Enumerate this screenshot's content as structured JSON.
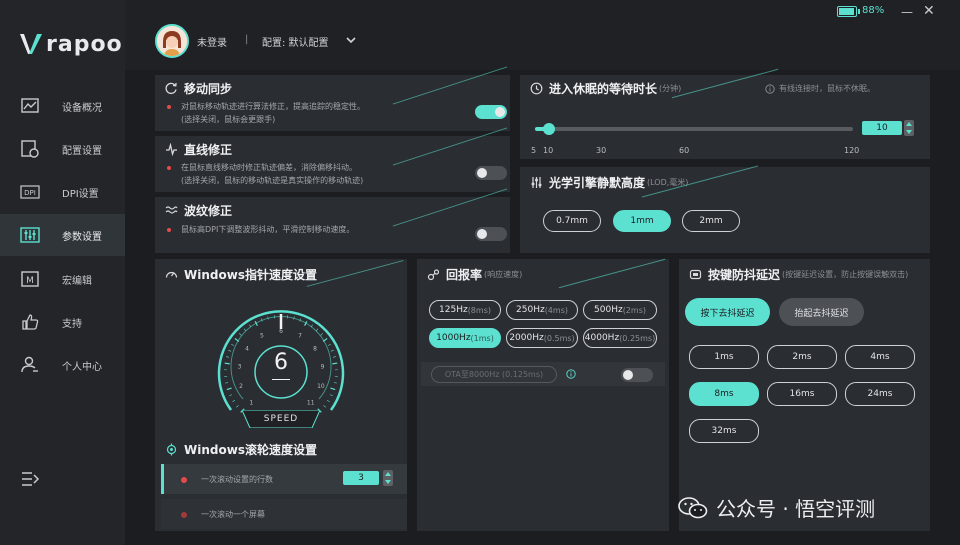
{
  "brand": {
    "name": "rapoo"
  },
  "window": {
    "battery": "88%",
    "battery_level": 0.88,
    "minimize": "—",
    "close": "✕"
  },
  "user": {
    "login_status": "未登录",
    "separator": "|",
    "config_label": "配置: 默认配置"
  },
  "sidebar": {
    "items": [
      {
        "label": "设备概况",
        "icon": "chart-icon"
      },
      {
        "label": "配置设置",
        "icon": "config-icon"
      },
      {
        "label": "DPI设置",
        "icon": "dpi-icon"
      },
      {
        "label": "参数设置",
        "icon": "sliders-icon",
        "active": true
      },
      {
        "label": "宏编辑",
        "icon": "macro-icon"
      },
      {
        "label": "支持",
        "icon": "thumbs-up-icon"
      },
      {
        "label": "个人中心",
        "icon": "user-icon"
      }
    ]
  },
  "motion_sync": {
    "title": "移动同步",
    "desc1": "对鼠标移动轨迹进行算法修正，提高追踪的稳定性。",
    "desc2": "(选择关闭，鼠标会更跟手)",
    "enabled": true
  },
  "line_correction": {
    "title": "直线修正",
    "desc1": "在鼠标直线移动时修正轨迹偏差，消除偏移抖动。",
    "desc2": "(选择关闭，鼠标的移动轨迹是真实操作的移动轨迹)",
    "enabled": false
  },
  "ripple_correction": {
    "title": "波纹修正",
    "desc1": "鼠标高DPI下调整波形抖动，平滑控制移动速度。",
    "enabled": false
  },
  "sleep": {
    "title": "进入休眠的等待时长",
    "unit": "(分钟)",
    "note": "有线连接时，鼠标不休眠。",
    "value": "10",
    "min": 5,
    "max": 120,
    "ticks": [
      "5",
      "10",
      "30",
      "60",
      "120"
    ]
  },
  "lod": {
    "title": "光学引擎静默高度",
    "unit": "(LOD,毫米)",
    "options": [
      "0.7mm",
      "1mm",
      "2mm"
    ],
    "selected": "1mm"
  },
  "pointer_speed": {
    "title": "Windows指针速度设置",
    "value": "6",
    "label": "SPEED",
    "dial_ticks": [
      "1",
      "2",
      "3",
      "4",
      "5",
      "6",
      "7",
      "8",
      "9",
      "10",
      "11"
    ]
  },
  "wheel_speed": {
    "title": "Windows滚轮速度设置",
    "row1": "一次滚动设置的行数",
    "row1_value": "3",
    "row2": "一次滚动一个屏幕"
  },
  "polling": {
    "title": "回报率",
    "unit": "(响应速度)",
    "options": [
      {
        "main": "125Hz",
        "sub": "(8ms)"
      },
      {
        "main": "250Hz",
        "sub": "(4ms)"
      },
      {
        "main": "500Hz",
        "sub": "(2ms)"
      },
      {
        "main": "1000Hz",
        "sub": "(1ms)",
        "selected": true
      },
      {
        "main": "2000Hz",
        "sub": "(0.5ms)"
      },
      {
        "main": "4000Hz",
        "sub": "(0.25ms)"
      }
    ],
    "ota_label": "OTA至8000Hz (0.125ms)",
    "ota_enabled": false
  },
  "debounce": {
    "title": "按键防抖延迟",
    "note": "(按键延迟设置，防止按键误触双击)",
    "press_btn": "按下去抖延迟",
    "release_btn": "抬起去抖延迟",
    "options": [
      "1ms",
      "2ms",
      "4ms",
      "8ms",
      "16ms",
      "24ms",
      "32ms"
    ],
    "selected": "8ms"
  },
  "watermark": {
    "text": "公众号 · 悟空评测"
  },
  "colors": {
    "accent": "#5ce0d0",
    "panel": "#2a2d31",
    "background": "#1b1d21",
    "alert": "#e84a4a"
  }
}
